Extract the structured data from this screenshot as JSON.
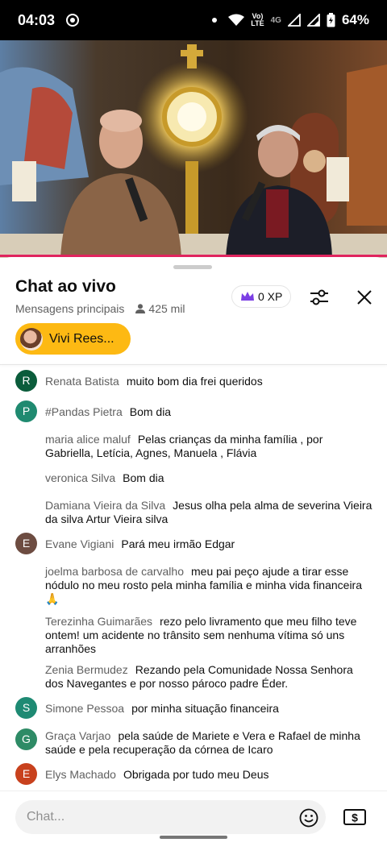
{
  "status_bar": {
    "time": "04:03",
    "volte_top": "Vo)",
    "volte_bottom": "LTE",
    "network": "4G",
    "battery": "64%"
  },
  "chat": {
    "title": "Chat ao vivo",
    "mode": "Mensagens principais",
    "viewers": "425 mil",
    "xp_label": "0 XP",
    "pinned_name": "Vivi Rees..."
  },
  "messages": [
    {
      "author": "Renata Batista",
      "text": "muito bom dia frei queridos",
      "avatar_letter": "R",
      "avatar_color": "#0b5c3b"
    },
    {
      "author": "#Pandas Pietra",
      "text": "Bom dia",
      "avatar_letter": "P",
      "avatar_color": "#1f8a70"
    },
    {
      "author": "maria alice maluf",
      "text": "Pelas crianças da minha família , por Gabriella, Letícia, Agnes, Manuela , Flávia",
      "avatar_letter": "",
      "avatar_color": ""
    },
    {
      "author": "veronica Silva",
      "text": "Bom dia",
      "avatar_letter": "",
      "avatar_color": ""
    },
    {
      "author": "Damiana Vieira da Silva",
      "text": "Jesus olha pela alma de severina Vieira da silva Artur Vieira silva",
      "avatar_letter": "",
      "avatar_color": ""
    },
    {
      "author": "Evane Vigiani",
      "text": "Pará meu irmão Edgar",
      "avatar_letter": "E",
      "avatar_color": "#6d4c41"
    },
    {
      "author": "joelma barbosa de carvalho",
      "text": "meu pai peço ajude a tirar esse nódulo no meu rosto pela minha família e minha vida financeira 🙏",
      "avatar_letter": "",
      "avatar_color": ""
    },
    {
      "author": "Terezinha Guimarães",
      "text": "rezo pelo livramento que meu filho teve ontem! um acidente no trânsito sem nenhuma vítima só uns arranhões",
      "avatar_letter": "",
      "avatar_color": ""
    },
    {
      "author": "Zenia Bermudez",
      "text": "Rezando pela Comunidade Nossa Senhora dos Navegantes e por nosso pároco padre Éder.",
      "avatar_letter": "",
      "avatar_color": ""
    },
    {
      "author": "Simone Pessoa",
      "text": "por minha situação financeira",
      "avatar_letter": "S",
      "avatar_color": "#1e8a73"
    },
    {
      "author": "Graça Varjao",
      "text": "pela saúde de Mariete e Vera e Rafael de minha saúde e pela recuperação da córnea de Icaro",
      "avatar_letter": "G",
      "avatar_color": "#2e8b66"
    },
    {
      "author": "Elys Machado",
      "text": "Obrigada por tudo meu Deus",
      "avatar_letter": "E",
      "avatar_color": "#c8411d"
    }
  ],
  "input": {
    "placeholder": "Chat..."
  },
  "icons": {
    "crown": "crown-icon",
    "tune": "tune-icon",
    "close": "close-icon",
    "emoji": "emoji-icon",
    "super_chat": "super-chat-icon"
  }
}
